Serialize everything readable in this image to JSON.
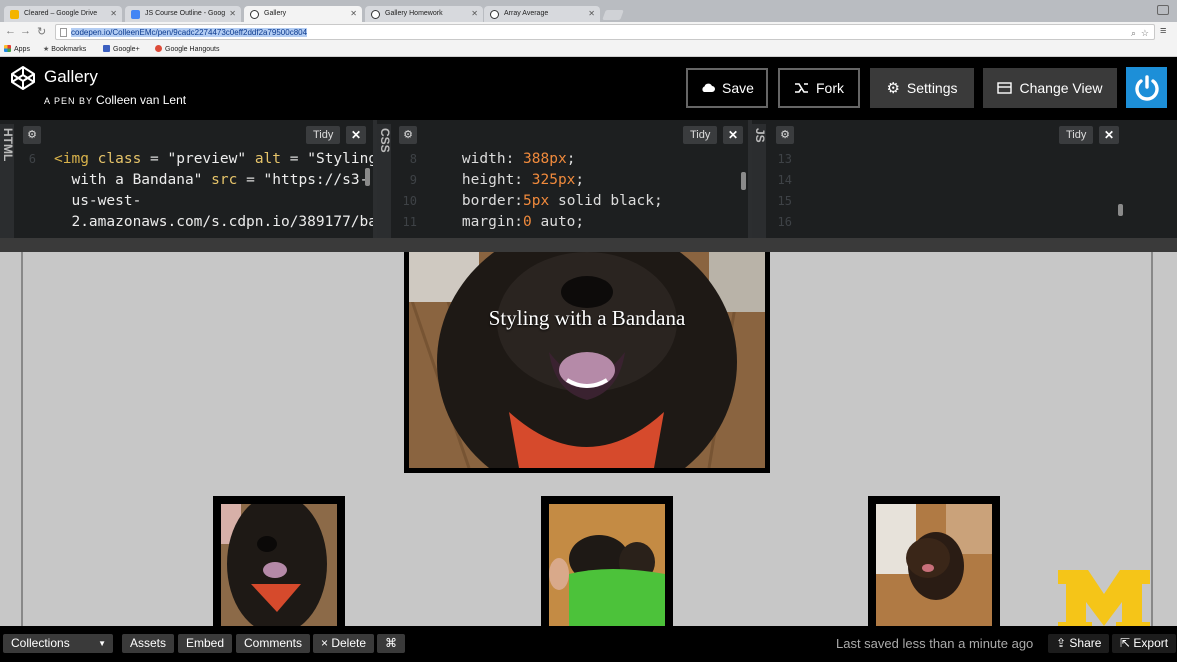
{
  "browser": {
    "tabs": [
      {
        "label": "Cleared – Google Drive",
        "color": "#f4b400"
      },
      {
        "label": "JS Course Outline - Goog",
        "color": "#4285f4"
      },
      {
        "label": "Gallery",
        "color": "#333333"
      },
      {
        "label": "Gallery Homework",
        "color": "#333333"
      },
      {
        "label": "Array Average",
        "color": "#333333"
      }
    ],
    "url_selected": "codepen.io",
    "url_rest": "/ColleenEMc/pen/9cadc2274473c0eff2ddf2a79500c804",
    "bookmarks": {
      "apps": "Apps",
      "bookmarks": "Bookmarks",
      "google_plus": "Google+",
      "hangouts": "Google Hangouts"
    }
  },
  "header": {
    "title": "Gallery",
    "by_label": "A PEN BY",
    "author": "Colleen van Lent",
    "save": "Save",
    "fork": "Fork",
    "settings": "Settings",
    "change_view": "Change View"
  },
  "editors": {
    "html": {
      "lang": "HTML",
      "tidy": "Tidy",
      "line_numbers": [
        "6",
        "",
        "",
        ""
      ],
      "lines": [
        [
          {
            "t": "<img ",
            "c": "t-tag"
          },
          {
            "t": "class",
            "c": "t-attr"
          },
          {
            "t": " = ",
            "c": "t-kw"
          },
          {
            "t": "\"preview\"",
            "c": "t-str"
          },
          {
            "t": " ",
            "c": ""
          },
          {
            "t": "alt",
            "c": "t-attr"
          },
          {
            "t": " = ",
            "c": "t-kw"
          },
          {
            "t": "\"Styling",
            "c": "t-str"
          }
        ],
        [
          {
            "t": "  with a Bandana\"",
            "c": "t-str"
          },
          {
            "t": " ",
            "c": ""
          },
          {
            "t": "src",
            "c": "t-attr"
          },
          {
            "t": " = ",
            "c": "t-kw"
          },
          {
            "t": "\"https://s3-",
            "c": "t-str"
          }
        ],
        [
          {
            "t": "  us-west-",
            "c": "t-str"
          }
        ],
        [
          {
            "t": "  2.amazonaws.com/s.cdpn.io/389177/ba",
            "c": "t-str"
          }
        ]
      ]
    },
    "css": {
      "lang": "CSS",
      "tidy": "Tidy",
      "line_numbers": [
        "8",
        "9",
        "10",
        "11"
      ],
      "lines": [
        [
          {
            "t": "    width: ",
            "c": "t-kw"
          },
          {
            "t": "388px",
            "c": "t-num"
          },
          {
            "t": ";",
            "c": "t-kw"
          }
        ],
        [
          {
            "t": "    height: ",
            "c": "t-kw"
          },
          {
            "t": "325px",
            "c": "t-num"
          },
          {
            "t": ";",
            "c": "t-kw"
          }
        ],
        [
          {
            "t": "    border:",
            "c": "t-kw"
          },
          {
            "t": "5px",
            "c": "t-num"
          },
          {
            "t": " solid black;",
            "c": "t-kw"
          }
        ],
        [
          {
            "t": "    margin:",
            "c": "t-kw"
          },
          {
            "t": "0",
            "c": "t-num"
          },
          {
            "t": " auto;",
            "c": "t-kw"
          }
        ]
      ]
    },
    "js": {
      "lang": "JS",
      "tidy": "Tidy",
      "line_numbers": [
        "13",
        "14",
        "15",
        "16"
      ]
    }
  },
  "preview": {
    "caption": "Styling with a Bandana"
  },
  "footer": {
    "collections": "Collections",
    "assets": "Assets",
    "embed": "Embed",
    "comments": "Comments",
    "delete": "× Delete",
    "shortcut": "⌘",
    "saved_status": "Last saved less than a minute ago",
    "share": "Share",
    "export": "Export"
  },
  "colors": {
    "accent": "#1d8fd8",
    "michigan_maize": "#f5c518"
  }
}
